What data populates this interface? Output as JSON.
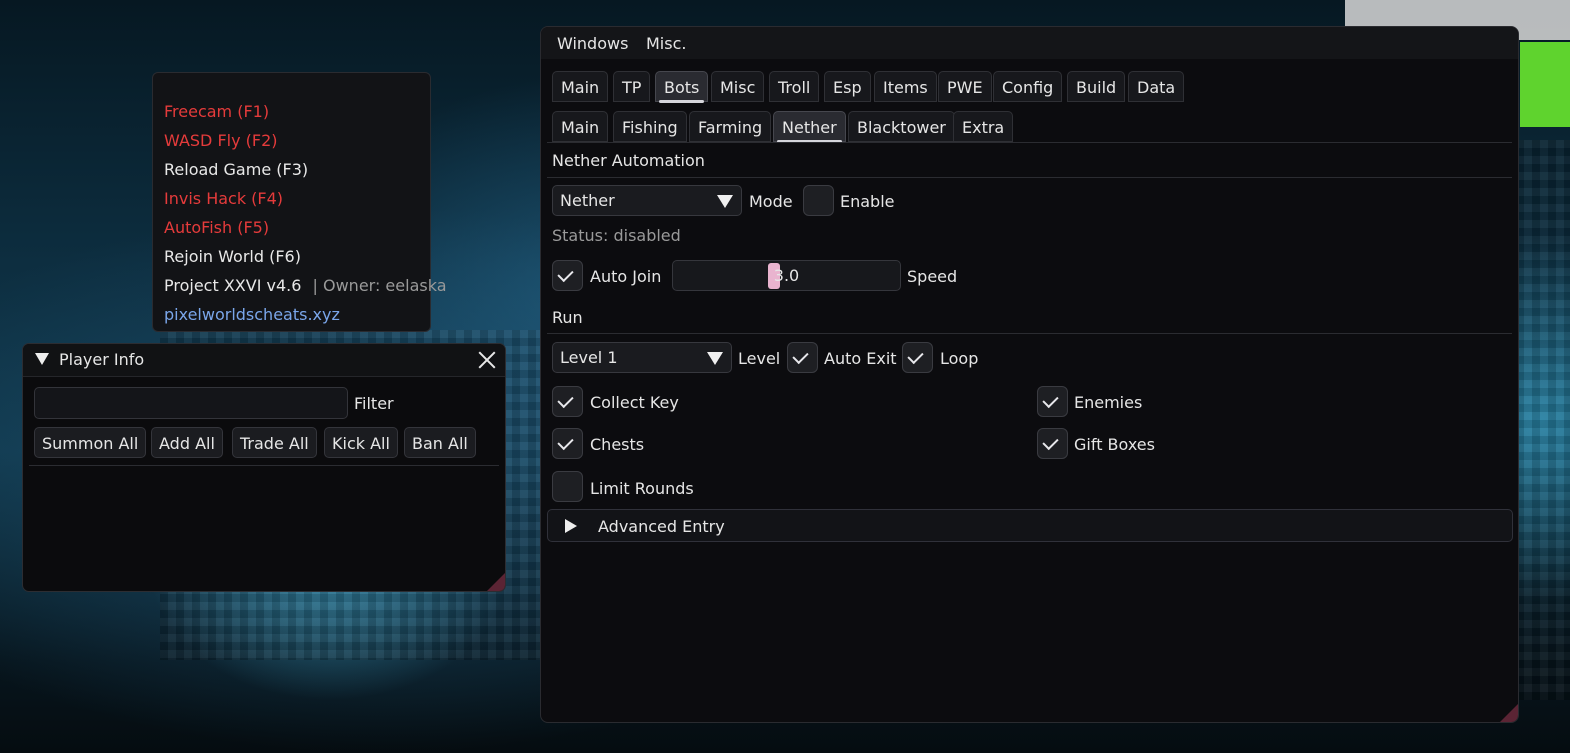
{
  "overlay": {
    "items": [
      {
        "label": "Freecam (F1)",
        "color": "#e53b3b"
      },
      {
        "label": "WASD Fly (F2)",
        "color": "#e53b3b"
      },
      {
        "label": "Reload Game (F3)",
        "color": "#e8e8e8"
      },
      {
        "label": "Invis Hack (F4)",
        "color": "#e53b3b"
      },
      {
        "label": "AutoFish (F5)",
        "color": "#e53b3b"
      },
      {
        "label": "Rejoin World (F6)",
        "color": "#e8e8e8"
      }
    ],
    "version": "Project XXVI v4.6",
    "owner": "| Owner: eelaska",
    "website": "pixelworldscheats.xyz"
  },
  "player_info": {
    "title": "Player Info",
    "filter_label": "Filter",
    "filter_value": "",
    "buttons": [
      "Summon All",
      "Add All",
      "Trade All",
      "Kick All",
      "Ban All"
    ]
  },
  "main": {
    "menubar": [
      "Windows",
      "Misc."
    ],
    "tabs": [
      "Main",
      "TP",
      "Bots",
      "Misc",
      "Troll",
      "Esp",
      "Items",
      "PWE",
      "Config",
      "Build",
      "Data"
    ],
    "active_tab": "Bots",
    "subtabs": [
      "Main",
      "Fishing",
      "Farming",
      "Nether",
      "Blacktower",
      "Extra"
    ],
    "active_subtab": "Nether",
    "section_title": "Nether Automation",
    "mode": {
      "value": "Nether",
      "label": "Mode"
    },
    "enable": {
      "label": "Enable",
      "checked": false
    },
    "status": "Status: disabled",
    "auto_join": {
      "label": "Auto Join",
      "checked": true
    },
    "speed": {
      "value": "3.0",
      "label": "Speed",
      "fraction": 0.5
    },
    "run_title": "Run",
    "level": {
      "value": "Level 1",
      "label": "Level"
    },
    "auto_exit": {
      "label": "Auto Exit",
      "checked": true
    },
    "loop": {
      "label": "Loop",
      "checked": true
    },
    "collect_key": {
      "label": "Collect Key",
      "checked": true
    },
    "enemies": {
      "label": "Enemies",
      "checked": true
    },
    "chests": {
      "label": "Chests",
      "checked": true
    },
    "gift_boxes": {
      "label": "Gift Boxes",
      "checked": true
    },
    "limit_rounds": {
      "label": "Limit Rounds",
      "checked": false
    },
    "advanced": "Advanced Entry"
  },
  "colors": {
    "accent": "#e9b4cf",
    "resize_grip": "#5b2434",
    "warning_text": "#e53b3b",
    "link": "#7aa6ea"
  }
}
